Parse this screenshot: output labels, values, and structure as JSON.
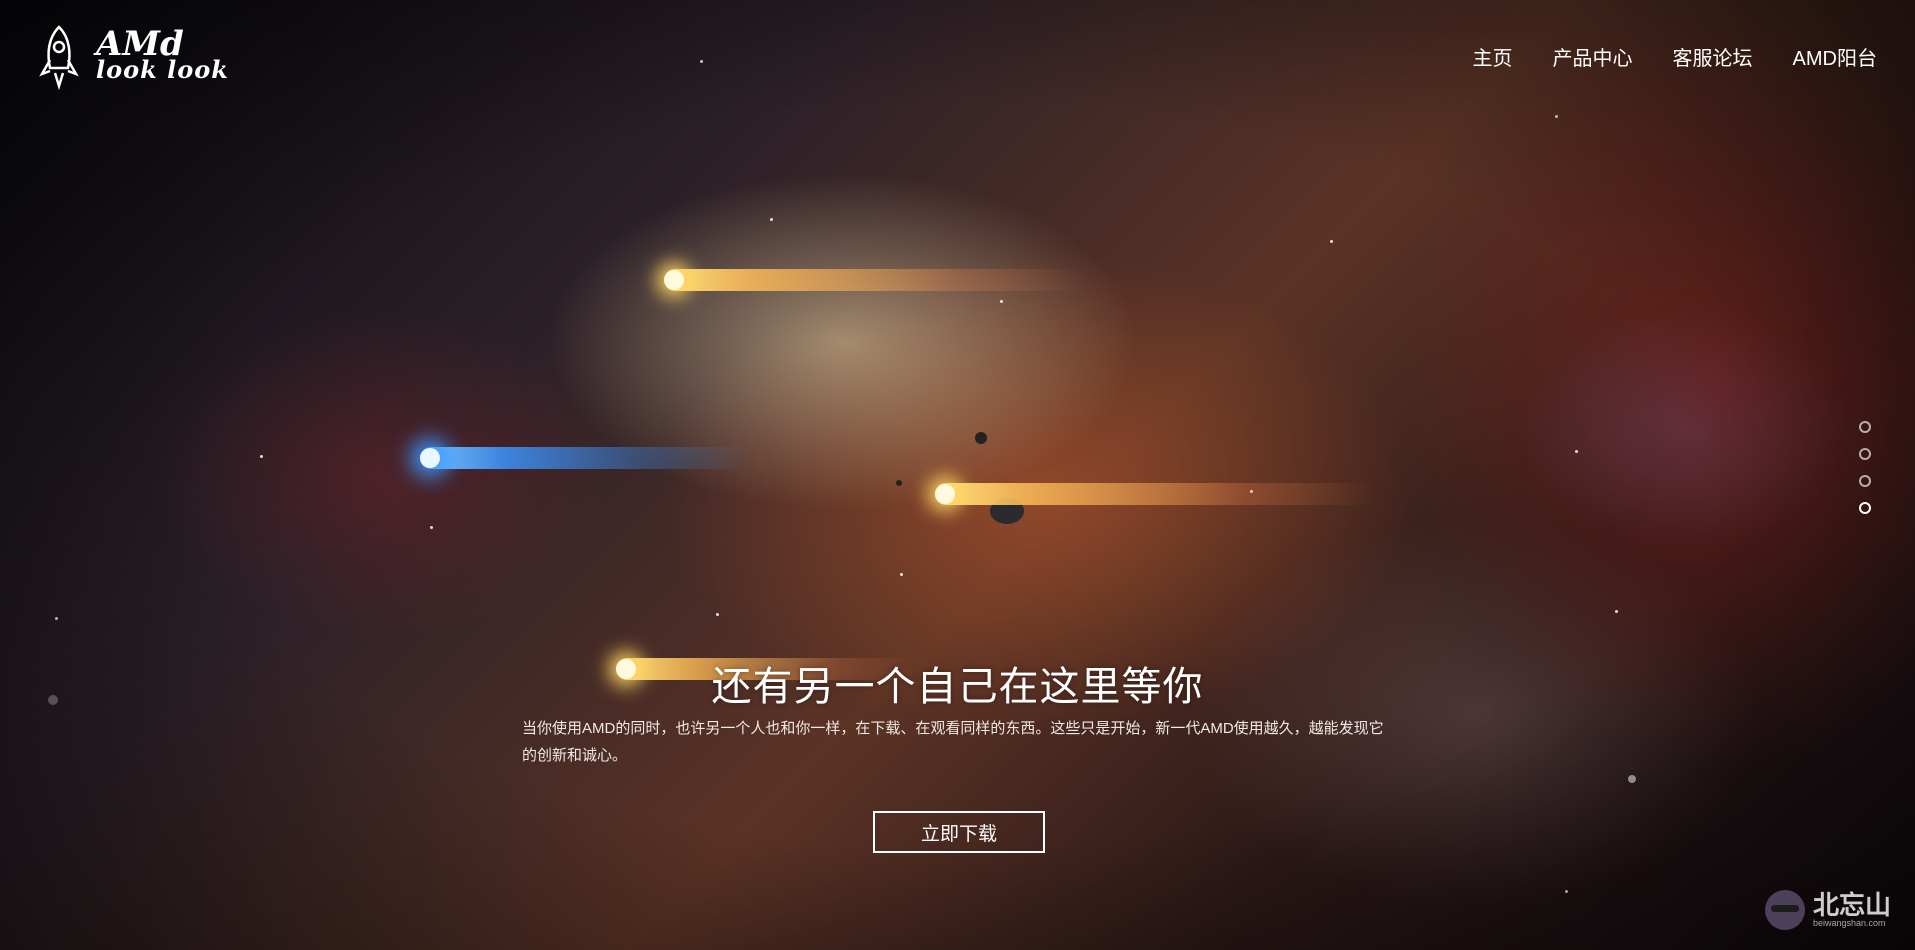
{
  "brand": {
    "logo_line1": "AMd",
    "logo_line2": "look look",
    "logo_icon": "rocket-icon"
  },
  "nav": {
    "items": [
      "主页",
      "产品中心",
      "客服论坛",
      "AMD阳台"
    ]
  },
  "hero": {
    "title": "还有另一个自己在这里等你",
    "description": "当你使用AMD的同时，也许另一个人也和你一样，在下载、在观看同样的东西。这些只是开始，新一代AMD使用越久，越能发现它的创新和诚心。",
    "button_label": "立即下载"
  },
  "pager": {
    "count": 4,
    "active_index": 3
  },
  "watermark": {
    "text": "北忘山",
    "subtext": "beiwangshan.com"
  },
  "colors": {
    "text": "#ffffff",
    "comet_gold": "#ffd76a",
    "comet_blue": "#3aa2ff"
  }
}
